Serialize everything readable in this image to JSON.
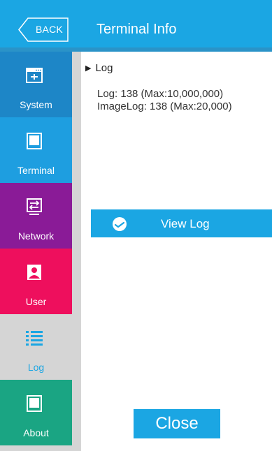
{
  "header": {
    "back_label": "BACK",
    "title": "Terminal Info",
    "color": "#1ba6e3"
  },
  "sidebar": {
    "items": [
      {
        "label": "System",
        "icon": "system-window-icon",
        "color": "#1d86c7"
      },
      {
        "label": "Terminal",
        "icon": "tablet-icon",
        "color": "#1e9ee0"
      },
      {
        "label": "Network",
        "icon": "network-arrows-icon",
        "color": "#8a1b97"
      },
      {
        "label": "User",
        "icon": "user-icon",
        "color": "#ee0f5d"
      },
      {
        "label": "Log",
        "icon": "list-icon",
        "color": "#d5d5d5",
        "selected": true
      },
      {
        "label": "About",
        "icon": "tablet-icon",
        "color": "#1aa583"
      }
    ]
  },
  "main": {
    "section_title": "Log",
    "log_line": "Log: 138 (Max:10,000,000)",
    "imagelog_line": "ImageLog: 138 (Max:20,000)",
    "view_log_label": "View Log",
    "close_label": "Close"
  }
}
